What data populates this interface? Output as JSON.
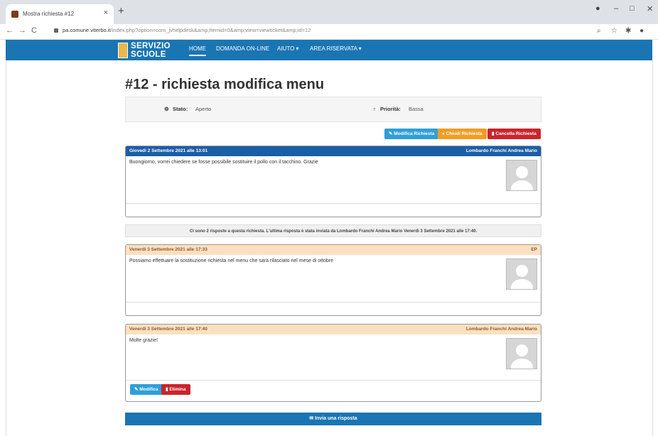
{
  "browser": {
    "tab_title": "Mostra richiesta #12",
    "tab_close": "×",
    "new_tab": "+",
    "url_host": "pa.comune.viterbo.it",
    "url_path": "/index.php?option=com_jvhelpdesk&amp;Itemid=0&amp;view=viewticket&amp;id=12",
    "back": "←",
    "forward": "→",
    "reload": "C",
    "minimize": "–",
    "maximize": "□",
    "close": "✕",
    "search_icon": "⌕",
    "star_icon": "☆",
    "ext_icon": "✱",
    "profile_icon": "●"
  },
  "site": {
    "logo_line1": "SERVIZIO",
    "logo_line2": "SCUOLE",
    "menu": [
      "HOME",
      "DOMANDA ON-LINE",
      "AIUTO ▾",
      "AREA RISERVATA ▾"
    ]
  },
  "ticket": {
    "title": "#12 - richiesta modifica menu",
    "status_label": "Stato:",
    "status_value": "Aperto",
    "priority_label": "Priorità:",
    "priority_value": "Bassa",
    "status_icon": "⚙",
    "priority_icon": "↑"
  },
  "actions": {
    "edit": "✎ Modifica Richiesta",
    "close": "● Chiudi Richiesta",
    "delete": "▮ Cancella Richiesta"
  },
  "messages": [
    {
      "date": "Giovedì 2 Settembre 2021 alle 13:01",
      "author": "Lombardo Franchi Andrea Mario",
      "text": "Buongiorno, vorrei chiedere se fosse possibile sostituire il pollo con il tacchino. Grazie"
    },
    {
      "date": "Venerdì 3 Settembre 2021 alle 17:33",
      "author": "EP",
      "text": "Possiamo effettuare la sostituzione richiesta nel menu che sarà rilasciato nel mese di ottobre"
    },
    {
      "date": "Venerdì 3 Settembre 2021 alle 17:40",
      "author": "Lombardo Franchi Andrea Mario",
      "text": "Molte grazie!"
    }
  ],
  "info": "Ci sono 2 risposte a questa richiesta. L'ultima risposta è stata inviata da Lombardo Franchi Andrea Mario Venerdì 3 Settembre 2021 alle 17:40.",
  "message_actions": {
    "edit": "✎ Modifica",
    "delete": "▮ Elimina"
  },
  "reply": "✉ Invia una risposta"
}
